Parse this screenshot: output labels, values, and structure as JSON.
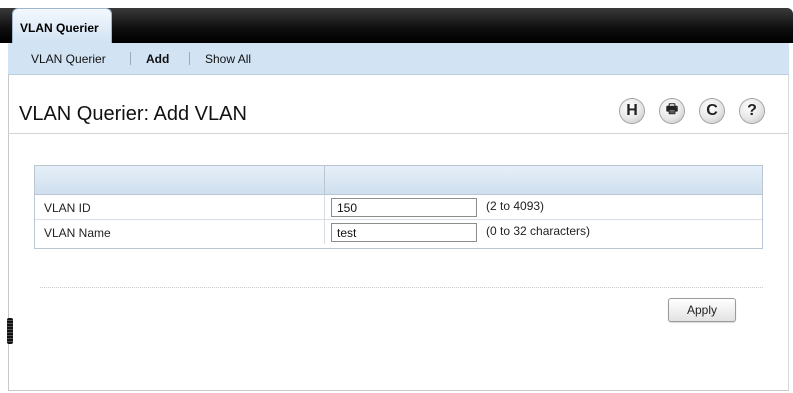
{
  "topbar": {
    "tab_label": "VLAN Querier"
  },
  "subnav": {
    "items": [
      {
        "label": "VLAN Querier"
      },
      {
        "label": "Add"
      },
      {
        "label": "Show All"
      }
    ],
    "active": "Add"
  },
  "page": {
    "title": "VLAN Querier: Add VLAN"
  },
  "toolbar": {
    "save_glyph": "H",
    "print_glyph": "🖶",
    "refresh_glyph": "C",
    "help_glyph": "?"
  },
  "form": {
    "rows": [
      {
        "label": "VLAN ID",
        "value": "150",
        "hint": "(2 to 4093)"
      },
      {
        "label": "VLAN Name",
        "value": "test",
        "hint": "(0 to 32 characters)"
      }
    ]
  },
  "actions": {
    "apply_label": "Apply"
  }
}
